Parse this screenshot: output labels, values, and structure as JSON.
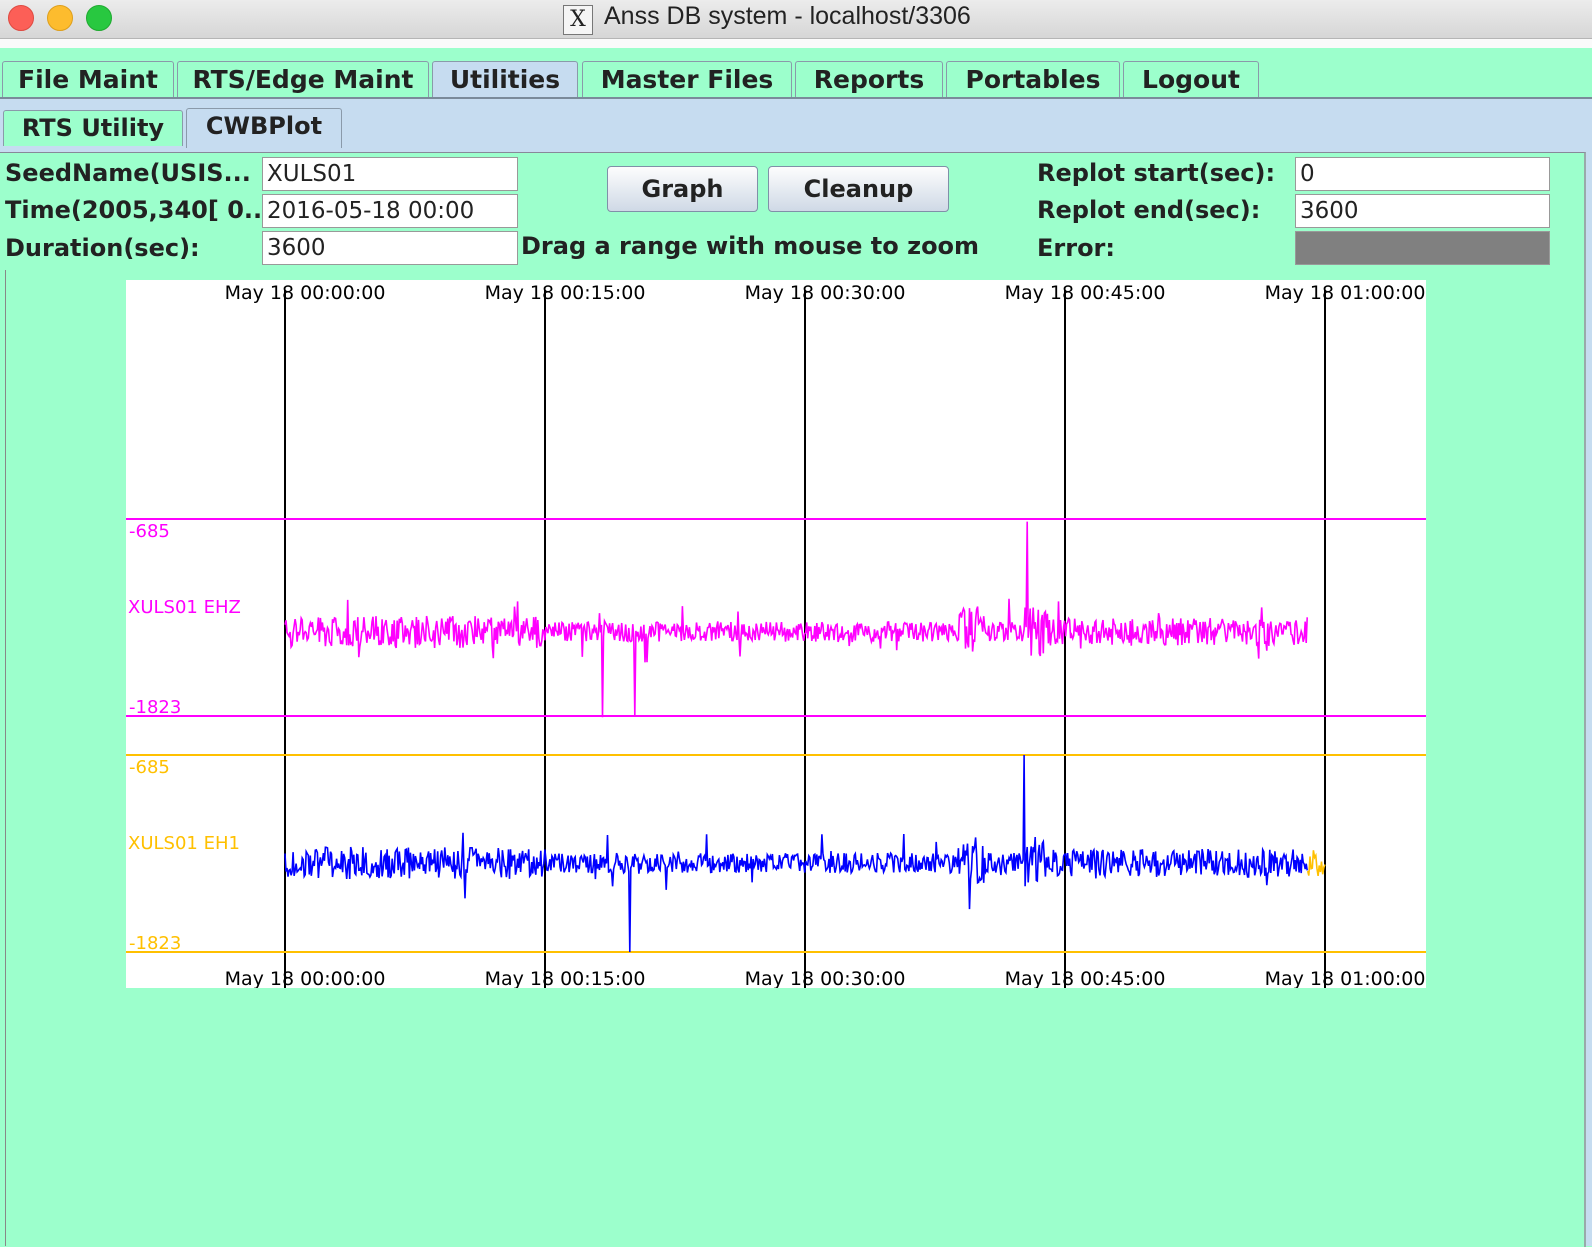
{
  "window": {
    "title": "Anss DB system - localhost/3306"
  },
  "tabs": [
    "File Maint",
    "RTS/Edge Maint",
    "Utilities",
    "Master Files",
    "Reports",
    "Portables",
    "Logout"
  ],
  "selected_tab": "Utilities",
  "subtabs": [
    "RTS Utility",
    "CWBPlot"
  ],
  "selected_subtab": "CWBPlot",
  "form": {
    "seedname_label": "SeedName(USIS...",
    "seedname_value": "XULS01",
    "time_label": "Time(2005,340[ 0...",
    "time_value": "2016-05-18 00:00",
    "duration_label": "Duration(sec):",
    "duration_value": "3600",
    "graph_button": "Graph",
    "cleanup_button": "Cleanup",
    "hint": "Drag a range with mouse to zoom",
    "replot_start_label": "Replot start(sec):",
    "replot_start_value": "0",
    "replot_end_label": "Replot end(sec):",
    "replot_end_value": "3600",
    "error_label": "Error:"
  },
  "chart_data": {
    "type": "line",
    "x_tick_labels": [
      "May 18 00:00:00",
      "May 18 00:15:00",
      "May 18 00:30:00",
      "May 18 00:45:00",
      "May 18 01:00:00"
    ],
    "x_range_sec": [
      0,
      3600
    ],
    "gridlines": "vertical at each x tick",
    "colors": {
      "ehz": "#ff00ff",
      "eh1_axis": "#ffc000",
      "eh1_trace": "#0000ff",
      "eh1_tail": "#ffc000"
    },
    "traces": [
      {
        "name": "XULS01 EHZ",
        "ymax_label": "-685",
        "ymin_label": "-1823",
        "series_color": "#ff00ff",
        "data_end_sec": 3560,
        "spikes": [
          {
            "t": 2570,
            "value": -700
          },
          {
            "t": 1210,
            "value": -1823
          },
          {
            "t": 1100,
            "value": -1830
          }
        ]
      },
      {
        "name": "XULS01 EH1",
        "ymax_label": "-685",
        "ymin_label": "-1823",
        "series_color": "#0000ff",
        "tail_color": "#ffc000",
        "data_end_sec": 3600,
        "spikes": [
          {
            "t": 2560,
            "value": -685
          },
          {
            "t": 1195,
            "value": -1823
          }
        ]
      }
    ]
  }
}
